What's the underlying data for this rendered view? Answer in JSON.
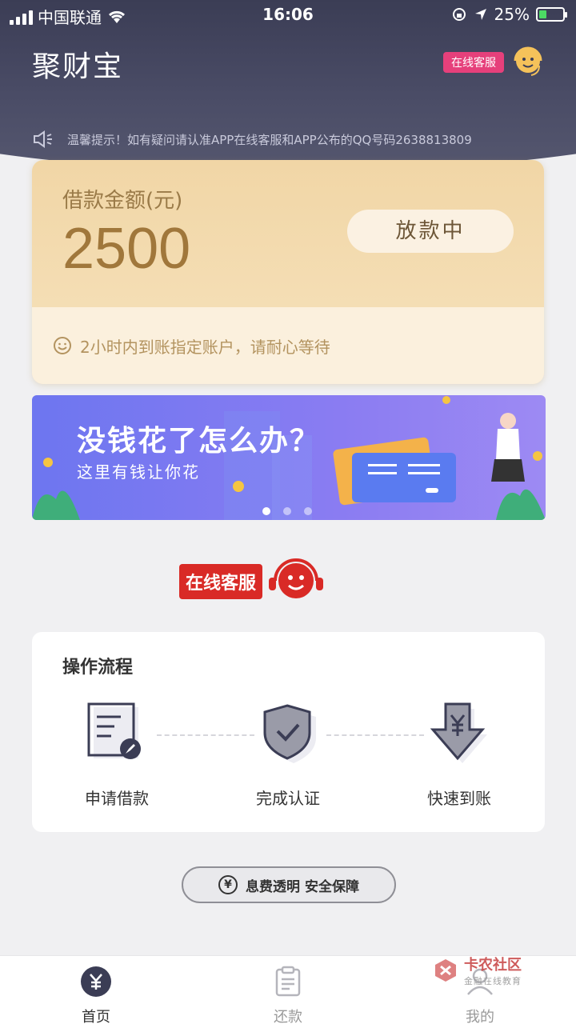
{
  "status_bar": {
    "carrier": "中国联通",
    "time": "16:06",
    "battery": "25%"
  },
  "header": {
    "app_title": "聚财宝",
    "online_service_tag": "在线客服"
  },
  "notice": {
    "text": "温馨提示！如有疑问请认准APP在线客服和APP公布的QQ号码2638813809"
  },
  "loan_card": {
    "label": "借款金额(元)",
    "amount": "2500",
    "status": "放款中",
    "tip": "2小时内到账指定账户，请耐心等待"
  },
  "banner": {
    "title": "没钱花了怎么办？",
    "subtitle": "这里有钱让你花",
    "slide_count": 3,
    "active_index": 0
  },
  "online_service": {
    "label": "在线客服"
  },
  "process": {
    "title": "操作流程",
    "steps": [
      {
        "label": "申请借款",
        "icon": "document-edit-icon"
      },
      {
        "label": "完成认证",
        "icon": "shield-check-icon"
      },
      {
        "label": "快速到账",
        "icon": "yen-download-icon"
      }
    ]
  },
  "badge": {
    "icon": "yen-circle-icon",
    "text": "息费透明 安全保障"
  },
  "tabbar": {
    "tabs": [
      {
        "label": "首页",
        "icon": "yen-home-icon",
        "active": true
      },
      {
        "label": "还款",
        "icon": "clipboard-icon",
        "active": false
      },
      {
        "label": "我的",
        "icon": "user-icon",
        "active": false
      }
    ]
  },
  "watermark": {
    "main": "卡农社区",
    "sub": "金融在线教育"
  },
  "colors": {
    "header_bg": "#3b3d55",
    "accent_gold": "#a0773b",
    "service_red": "#d92a26",
    "tag_pink": "#e6407b"
  }
}
